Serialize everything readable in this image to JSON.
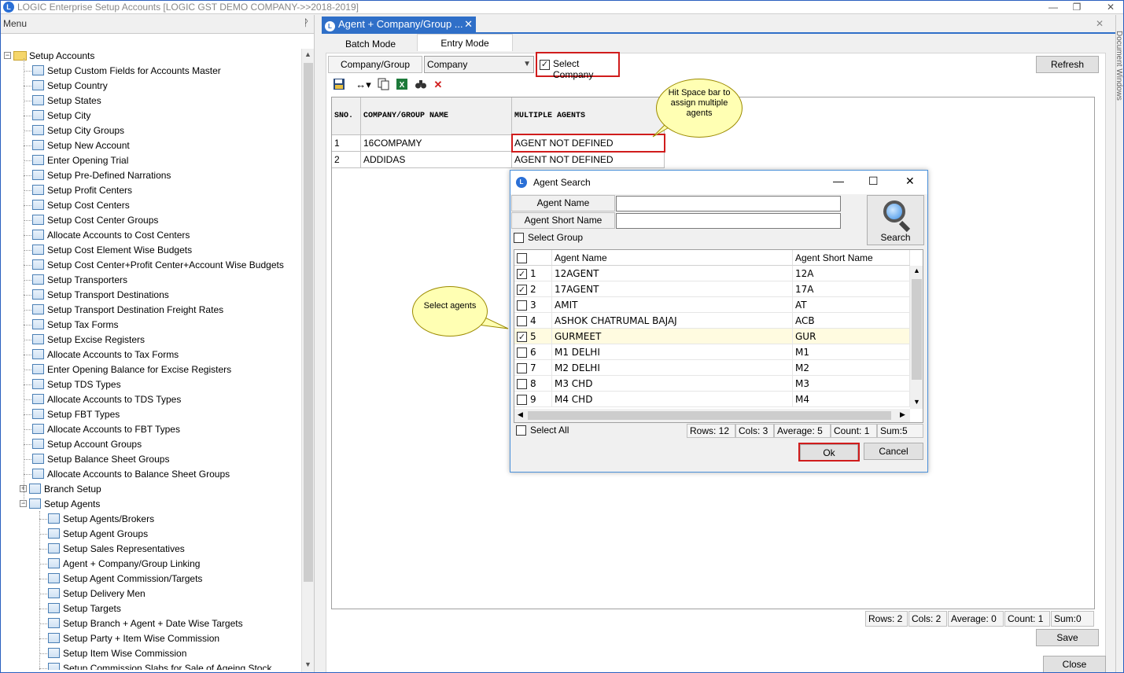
{
  "window": {
    "title": "LOGIC Enterprise Setup Accounts  [LOGIC GST DEMO COMPANY->>2018-2019]",
    "app_icon": "logic-app-icon",
    "min_glyph": "—",
    "max_glyph": "❐",
    "close_glyph": "✕"
  },
  "menu": {
    "title": "Menu",
    "pin_glyph": "ᚹ",
    "root": "Setup Accounts",
    "items": [
      "Setup Custom Fields for Accounts Master",
      "Setup Country",
      "Setup States",
      "Setup City",
      "Setup City Groups",
      "Setup New Account",
      "Enter Opening Trial",
      "Setup Pre-Defined Narrations",
      "Setup Profit Centers",
      "Setup Cost Centers",
      "Setup Cost Center Groups",
      "Allocate Accounts to Cost Centers",
      "Setup Cost Element Wise Budgets",
      "Setup Cost Center+Profit Center+Account Wise Budgets",
      "Setup Transporters",
      "Setup Transport Destinations",
      "Setup Transport Destination Freight Rates",
      "Setup Tax Forms",
      "Setup Excise Registers",
      "Allocate Accounts to Tax Forms",
      "Enter Opening Balance for Excise Registers",
      "Setup TDS Types",
      "Allocate Accounts to TDS Types",
      "Setup FBT Types",
      "Allocate Accounts to FBT Types",
      "Setup Account Groups",
      "Setup Balance Sheet Groups",
      "Allocate Accounts to Balance Sheet Groups"
    ],
    "branch_setup": "Branch Setup",
    "setup_agents": "Setup Agents",
    "agent_items": [
      "Setup Agents/Brokers",
      "Setup Agent Groups",
      "Setup Sales Representatives",
      "Agent + Company/Group Linking",
      "Setup Agent Commission/Targets",
      "Setup Delivery Men",
      "Setup Targets",
      "Setup Branch + Agent + Date Wise Targets",
      "Setup Party + Item Wise Commission",
      "Setup Item Wise Commission",
      "Setup Commission Slabs for Sale of Ageing Stock"
    ]
  },
  "doc_tab": {
    "label": "Agent + Company/Group ...",
    "close_glyph": "✕"
  },
  "side_strip": "Document Windows",
  "modes": {
    "batch": "Batch Mode",
    "entry": "Entry Mode"
  },
  "filter": {
    "label": "Company/Group",
    "value": "Company",
    "select_company": "Select Company",
    "select_company_checked": "✓"
  },
  "buttons": {
    "refresh": "Refresh",
    "save": "Save",
    "close": "Close"
  },
  "toolbar_icons": [
    "save-icon",
    "column-resize-icon",
    "copy-icon",
    "excel-icon",
    "find-icon",
    "delete-icon"
  ],
  "grid": {
    "headers": [
      "SNO.",
      "COMPANY/GROUP NAME",
      "MULTIPLE AGENTS"
    ],
    "rows": [
      [
        "1",
        "16COMPAMY",
        "AGENT NOT DEFINED"
      ],
      [
        "2",
        "ADDIDAS",
        "AGENT NOT DEFINED"
      ]
    ],
    "status": {
      "rows": "Rows: 2",
      "cols": "Cols: 2",
      "average": "Average: 0",
      "count": "Count: 1",
      "sum": "Sum:0"
    }
  },
  "callouts": {
    "space": "Hit Space bar to assign multiple agents",
    "select": "Select agents"
  },
  "dialog": {
    "title": "Agent Search",
    "agent_name_label": "Agent Name",
    "agent_short_label": "Agent Short Name",
    "agent_name_value": "",
    "agent_short_value": "",
    "select_group": "Select Group",
    "search": "Search",
    "headers": [
      "Agent Name",
      "Agent Short Name"
    ],
    "rows": [
      {
        "no": "1",
        "name": "12AGENT",
        "short": "12A",
        "checked": "✓"
      },
      {
        "no": "2",
        "name": "17AGENT",
        "short": "17A",
        "checked": "✓"
      },
      {
        "no": "3",
        "name": "AMIT",
        "short": "AT",
        "checked": ""
      },
      {
        "no": "4",
        "name": "ASHOK CHATRUMAL BAJAJ",
        "short": "ACB",
        "checked": ""
      },
      {
        "no": "5",
        "name": "GURMEET",
        "short": "GUR",
        "checked": "✓"
      },
      {
        "no": "6",
        "name": "M1 DELHI",
        "short": "M1",
        "checked": ""
      },
      {
        "no": "7",
        "name": "M2 DELHI",
        "short": "M2",
        "checked": ""
      },
      {
        "no": "8",
        "name": "M3 CHD",
        "short": "M3",
        "checked": ""
      },
      {
        "no": "9",
        "name": "M4 CHD",
        "short": "M4",
        "checked": ""
      }
    ],
    "select_all": "Select All",
    "status": {
      "rows": "Rows: 12",
      "cols": "Cols: 3",
      "average": "Average: 5",
      "count": "Count: 1",
      "sum": "Sum:5"
    },
    "ok": "Ok",
    "cancel": "Cancel"
  },
  "colors": {
    "accent": "#2f6fc8",
    "highlight": "#d01c1c",
    "callout": "#ffffb3"
  }
}
